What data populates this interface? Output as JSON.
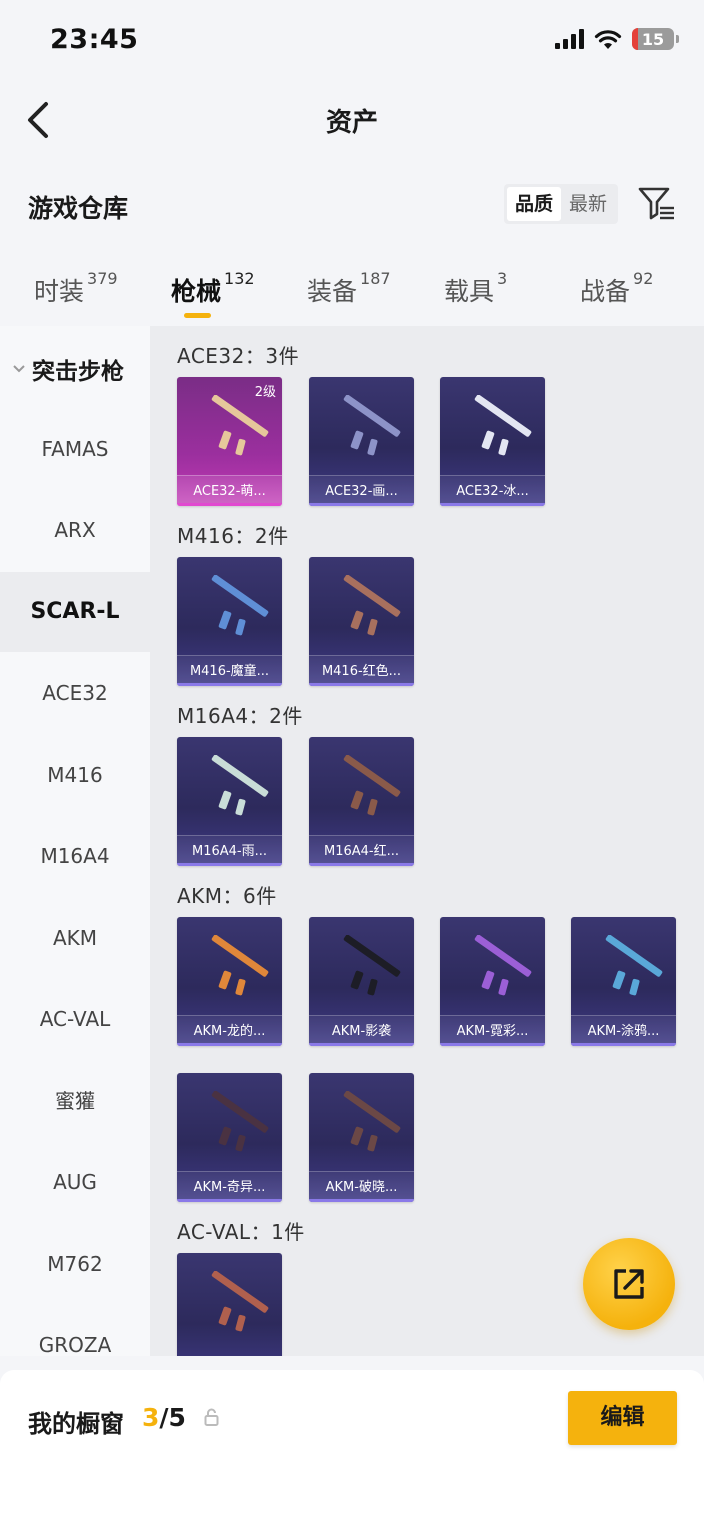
{
  "status": {
    "time": "23:45",
    "battery": "15"
  },
  "nav": {
    "title": "资产"
  },
  "header": {
    "title": "游戏仓库",
    "sort_quality": "品质",
    "sort_newest": "最新"
  },
  "tabs": [
    {
      "label": "时装",
      "count": "379"
    },
    {
      "label": "枪械",
      "count": "132"
    },
    {
      "label": "装备",
      "count": "187"
    },
    {
      "label": "载具",
      "count": "3"
    },
    {
      "label": "战备",
      "count": "92"
    }
  ],
  "sidebar": {
    "group": "突击步枪",
    "items": [
      "FAMAS",
      "ARX",
      "SCAR-L",
      "ACE32",
      "M416",
      "M16A4",
      "AKM",
      "AC-VAL",
      "蜜獾",
      "AUG",
      "M762",
      "GROZA"
    ]
  },
  "groups": [
    {
      "label": "ACE32：3件",
      "items": [
        {
          "name": "ACE32-萌...",
          "level": "2级"
        },
        {
          "name": "ACE32-画..."
        },
        {
          "name": "ACE32-冰..."
        }
      ]
    },
    {
      "label": "M416：2件",
      "items": [
        {
          "name": "M416-魔童..."
        },
        {
          "name": "M416-红色..."
        }
      ]
    },
    {
      "label": "M16A4：2件",
      "items": [
        {
          "name": "M16A4-雨..."
        },
        {
          "name": "M16A4-红..."
        }
      ]
    },
    {
      "label": "AKM：6件",
      "items": [
        {
          "name": "AKM-龙的..."
        },
        {
          "name": "AKM-影袭"
        },
        {
          "name": "AKM-霓彩..."
        },
        {
          "name": "AKM-涂鸦..."
        },
        {
          "name": "AKM-奇异..."
        },
        {
          "name": "AKM-破晓..."
        }
      ]
    },
    {
      "label": "AC-VAL：1件",
      "items": [
        {
          "name": ""
        }
      ]
    }
  ],
  "footer": {
    "title": "我的橱窗",
    "count_current": "3",
    "count_total": "/5",
    "edit_label": "编辑"
  },
  "colors": {
    "accent": "#f5b20d",
    "card_purple": "#2d2a5c",
    "card_pink": "#9b2f9e"
  }
}
